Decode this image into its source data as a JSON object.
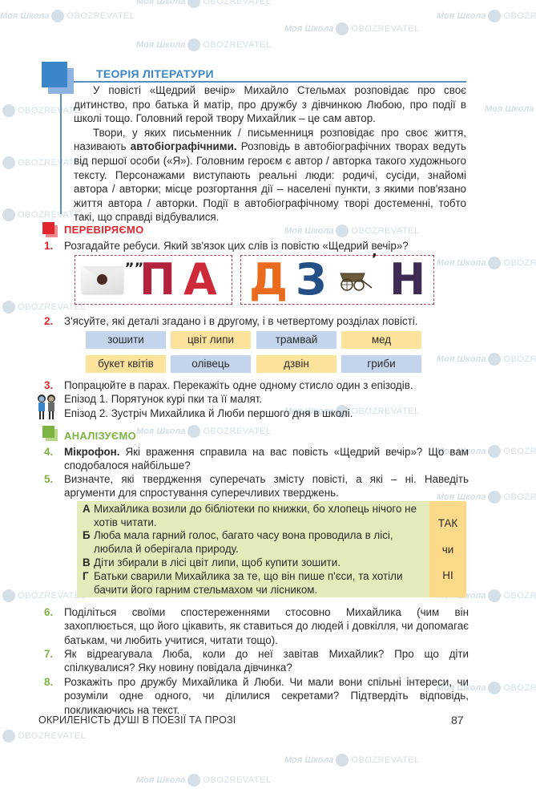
{
  "watermark": {
    "brand1": "Моя Школа",
    "brand2": "OBOZREVATEL"
  },
  "theory": {
    "title": "ТЕОРІЯ ЛІТЕРАТУРИ",
    "icon": "blue-squares-icon",
    "p1": "У повісті «Щедрий вечір» Михайло Стельмах розповідає про своє дитинство, про батька й матір, про дружбу з дівчинкою Любою, про події в школі тощо. Головний герой твору Михайлик – це сам автор.",
    "p2_before": "Твори, у яких письменник / письменниця розповідає про своє життя, називають ",
    "p2_bold": "автобіографічними.",
    "p2_after": " Розповідь в автобіографічних творах ведуть від першої особи («Я»). Головним героєм є автор / авторка такого художнього тексту. Персонажами виступають реальні люди: родичі, сусіди, знайомі автора / авторки; місце розгортання дії – населені пункти, з якими пов'язано життя автора / авторки. Події в автобіографічному творі достеменні, тобто такі, що справді відбувалися."
  },
  "check": {
    "title": "ПЕРЕВІРЯЄМО",
    "icon": "red-squares-icon",
    "colors": {
      "accent": "#e0262f"
    },
    "q1": {
      "num": "1.",
      "text": "Розгадайте ребуси. Який зв'язок цих слів із повістю «Щедрий вечір»?"
    },
    "rebus1": {
      "image": "envelope-icon",
      "commas": "„„",
      "letters": [
        "П",
        "А"
      ]
    },
    "rebus2": {
      "letters": [
        "Д",
        "З"
      ],
      "image": "cart-icon",
      "comma": "’",
      "last": "Н"
    },
    "q2": {
      "num": "2.",
      "text": "З'ясуйте, які деталі згадано і в другому, і в четвертому розділах повісті."
    },
    "words": [
      {
        "label": "зошити",
        "color": "blue"
      },
      {
        "label": "цвіт липи",
        "color": "yellow"
      },
      {
        "label": "трамвай",
        "color": "blue"
      },
      {
        "label": "мед",
        "color": "yellow"
      },
      {
        "label": "букет квітів",
        "color": "yellow"
      },
      {
        "label": "олівець",
        "color": "blue"
      },
      {
        "label": "дзвін",
        "color": "yellow"
      },
      {
        "label": "гриби",
        "color": "blue"
      }
    ],
    "q3": {
      "num": "3.",
      "text": "Попрацюйте в парах. Перекажіть одне одному стисло один з епізодів.",
      "icon": "pair-work-icon",
      "episodes": [
        "Епізод 1. Порятунок курі пки та її малят.",
        "Епізод 2. Зустріч Михайлика й Люби першого дня в школі."
      ]
    }
  },
  "analyze": {
    "title": "АНАЛІЗУЄМО",
    "icon": "green-squares-icon",
    "colors": {
      "accent": "#7cb342"
    },
    "q4": {
      "num": "4.",
      "bold": "Мікрофон.",
      "text": " Які враження справила на вас повість «Щедрий вечір»? Що вам сподобалося найбільше?"
    },
    "q5": {
      "num": "5.",
      "text": "Визначте, які твердження суперечать змісту повісті, а які – ні. Наведіть аргументи для спростування суперечливих тверджень."
    },
    "statements": [
      {
        "letter": "А",
        "text": "Михайлика возили до бібліотеки по книжки, бо хлопець нічого не хотів читати."
      },
      {
        "letter": "Б",
        "text": "Люба мала гарний голос, багато часу вона проводила в лісі, любила й оберігала природу."
      },
      {
        "letter": "В",
        "text": "Діти збирали в лісі цвіт липи, щоб купити зошити."
      },
      {
        "letter": "Г",
        "text": "Батьки сварили Михайлика за те, що він пише п'єси, та хотіли бачити його гарним стельмахом чи лісником."
      }
    ],
    "side": [
      "ТАК",
      "чи",
      "НІ"
    ],
    "q6": {
      "num": "6.",
      "text": "Поділіться своїми спостереженнями стосовно Михайлика (чим він захоплюється, що його цікавить, як ставиться до людей і довкілля, чи допомагає батькам, чи любить учитися, читати тощо)."
    },
    "q7": {
      "num": "7.",
      "text": "Як відреагувала Люба, коли до неї завітав Михайлик? Про що діти спілкувалися? Яку новину повідала дівчинка?"
    },
    "q8": {
      "num": "8.",
      "text": "Розкажіть про дружбу Михайлика й Люби. Чи мали вони спільні інтереси, чи розуміли одне одного, чи ділилися секретами? Підтвердіть відповідь, покликаючись на текст."
    }
  },
  "footer": {
    "section_title": "ОКРИЛЕНІСТЬ ДУШІ В ПОЕЗІЇ ТА ПРОЗІ",
    "page_number": "87"
  }
}
